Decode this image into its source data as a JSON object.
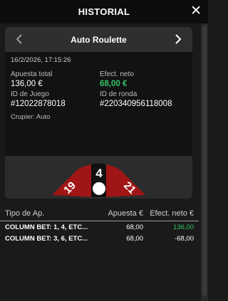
{
  "header": {
    "title": "HISTORIAL",
    "close_icon": "close-icon"
  },
  "card": {
    "game_title": "Auto Roulette",
    "prev_icon": "chevron-left-icon",
    "next_icon": "chevron-right-icon",
    "datetime": "16/2/2026, 17:15:26",
    "total_bet_label": "Apuesta total",
    "total_bet_value": "136,00 €",
    "net_cash_label": "Efect. neto",
    "net_cash_value": "68,00 €",
    "game_id_label": "ID de Juego",
    "game_id_value": "#12022878018",
    "round_id_label": "ID de ronda",
    "round_id_value": "#220340956118008",
    "dealer": "Crupier: Auto",
    "wheel": {
      "left": "19",
      "center": "4",
      "right": "21"
    }
  },
  "colors": {
    "red": "#a01515",
    "black": "#111111",
    "green": "#36c36a"
  },
  "table": {
    "headers": [
      "Tipo de Ap.",
      "Apuesta €",
      "Efect. neto €"
    ],
    "rows": [
      {
        "type": "COLUMN BET: 1, 4, ETC...",
        "bet": "68,00",
        "net": "136,00"
      },
      {
        "type": "COLUMN BET: 3, 6, ETC...",
        "bet": "68,00",
        "net": "-68,00"
      }
    ]
  }
}
